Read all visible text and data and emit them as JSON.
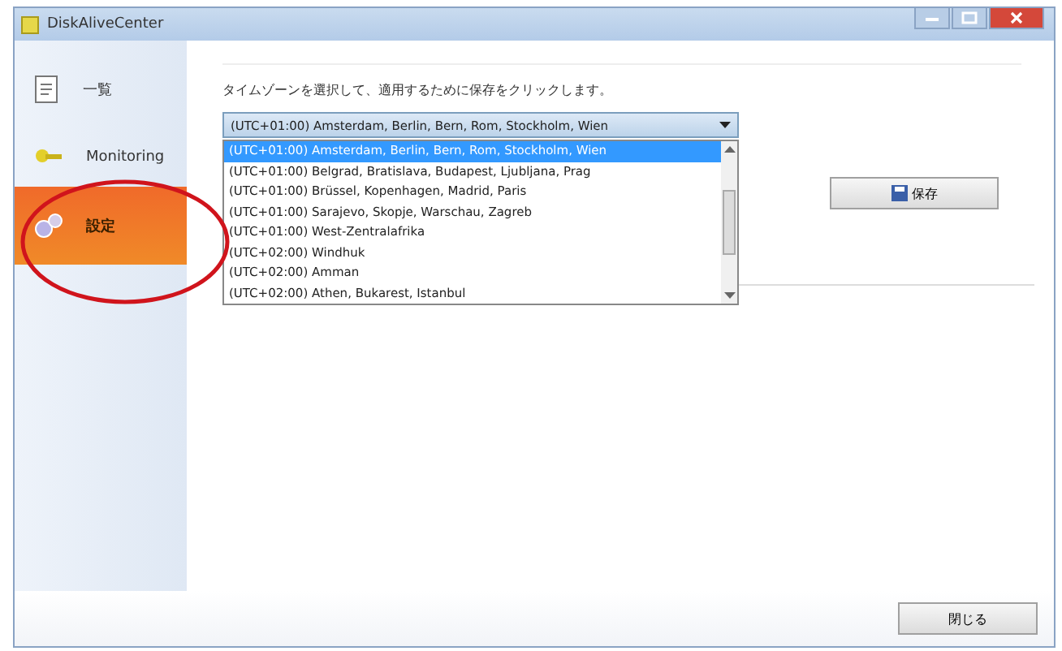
{
  "window": {
    "title": "DiskAliveCenter"
  },
  "sidebar": {
    "items": [
      {
        "label": "一覧",
        "kind": "document",
        "selected": false
      },
      {
        "label": "Monitoring",
        "kind": "key",
        "selected": false
      },
      {
        "label": "設定",
        "kind": "gears",
        "selected": true
      }
    ]
  },
  "settings": {
    "instruction": "タイムゾーンを選択して、適用するために保存をクリックします。",
    "timezone": {
      "value": "(UTC+01:00) Amsterdam, Berlin, Bern, Rom, Stockholm, Wien",
      "options": [
        {
          "label": "(UTC+01:00) Amsterdam, Berlin, Bern, Rom, Stockholm, Wien",
          "selected": true
        },
        {
          "label": "(UTC+01:00) Belgrad, Bratislava, Budapest, Ljubljana, Prag",
          "selected": false
        },
        {
          "label": "(UTC+01:00) Brüssel, Kopenhagen, Madrid, Paris",
          "selected": false
        },
        {
          "label": "(UTC+01:00) Sarajevo, Skopje, Warschau, Zagreb",
          "selected": false
        },
        {
          "label": "(UTC+01:00) West-Zentralafrika",
          "selected": false
        },
        {
          "label": "(UTC+02:00) Windhuk",
          "selected": false
        },
        {
          "label": "(UTC+02:00) Amman",
          "selected": false
        },
        {
          "label": "(UTC+02:00) Athen, Bukarest, Istanbul",
          "selected": false
        }
      ]
    },
    "save_button": "保存"
  },
  "close_button": "閉じる"
}
